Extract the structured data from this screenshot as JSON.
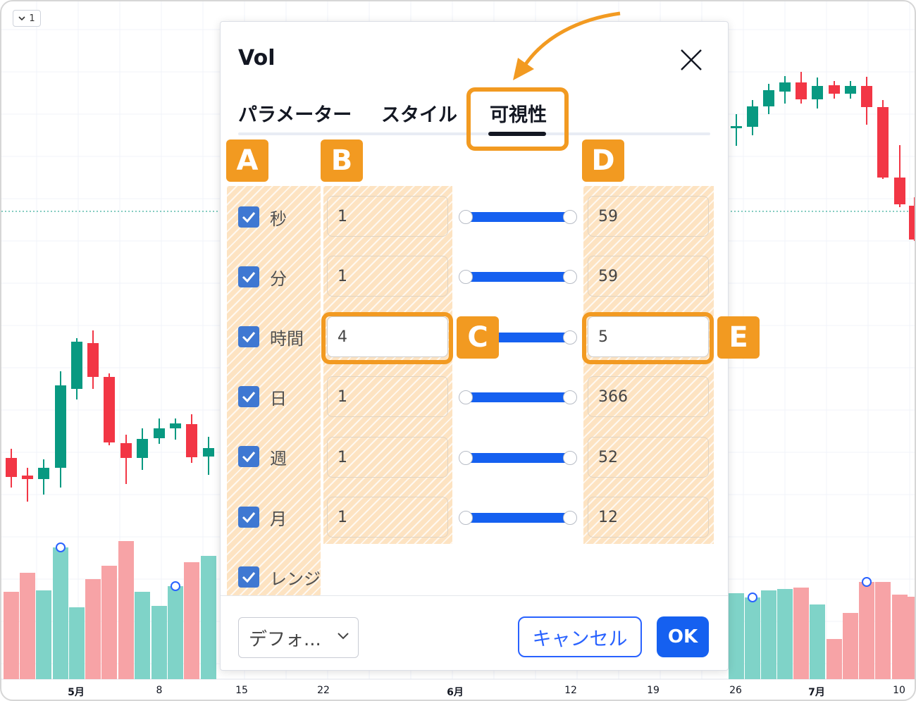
{
  "toolbar": {
    "collapse_count": "1"
  },
  "dialog": {
    "title": "Vol",
    "tabs": [
      {
        "label": "パラメーター",
        "active": false
      },
      {
        "label": "スタイル",
        "active": false
      },
      {
        "label": "可視性",
        "active": true
      }
    ],
    "rows": [
      {
        "label": "秒",
        "checked": true,
        "min": "1",
        "max": "59"
      },
      {
        "label": "分",
        "checked": true,
        "min": "1",
        "max": "59"
      },
      {
        "label": "時間",
        "checked": true,
        "min": "4",
        "max": "5"
      },
      {
        "label": "日",
        "checked": true,
        "min": "1",
        "max": "366"
      },
      {
        "label": "週",
        "checked": true,
        "min": "1",
        "max": "52"
      },
      {
        "label": "月",
        "checked": true,
        "min": "1",
        "max": "12"
      },
      {
        "label": "レンジ",
        "checked": true
      }
    ],
    "preset_select": "デフォ...",
    "cancel_label": "キャンセル",
    "ok_label": "OK"
  },
  "annotations": [
    "A",
    "B",
    "C",
    "D",
    "E"
  ],
  "chart": {
    "x_labels": [
      "5月",
      "8",
      "15",
      "22",
      "6月",
      "12",
      "19",
      "26",
      "7月",
      "10"
    ],
    "colors": {
      "up": "#089981",
      "down": "#f23645",
      "volume_up": "#7fd3c8",
      "volume_down": "#f7a3a6",
      "accent": "#f29a21",
      "primary": "#1560f0"
    }
  }
}
